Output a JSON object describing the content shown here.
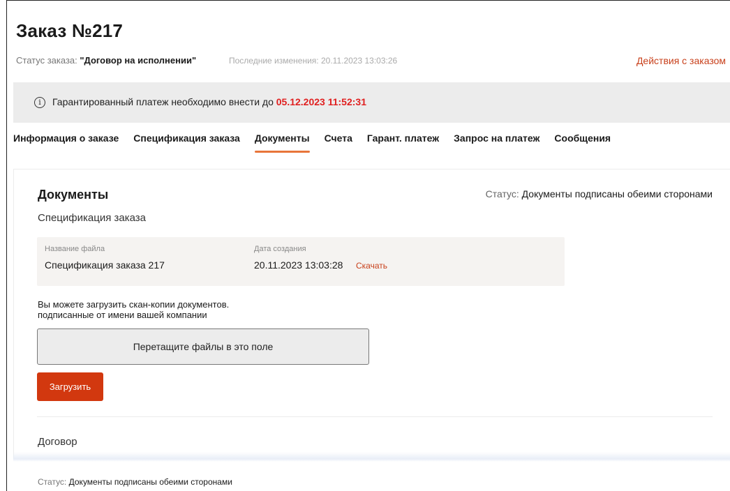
{
  "header": {
    "title": "Заказ №217",
    "status_label": "Статус заказа:",
    "status_value": "\"Договор на исполнении\"",
    "last_change": "Последние изменения: 20.11.2023 13:03:26",
    "actions_link": "Действия с заказом"
  },
  "notice": {
    "icon": "info-icon",
    "text": "Гарантированный платеж необходимо внести до",
    "deadline": "05.12.2023 11:52:31",
    "deadline_color": "#e02020"
  },
  "tabs": [
    {
      "label": "Информация о заказе",
      "active": false
    },
    {
      "label": "Спецификация заказа",
      "active": false
    },
    {
      "label": "Документы",
      "active": true
    },
    {
      "label": "Счета",
      "active": false
    },
    {
      "label": "Гарант. платеж",
      "active": false
    },
    {
      "label": "Запрос на платеж",
      "active": false
    },
    {
      "label": "Сообщения",
      "active": false
    }
  ],
  "documents": {
    "title": "Документы",
    "status_label": "Статус:",
    "status_value": "Документы подписаны обеими сторонами",
    "specification": {
      "section_title": "Спецификация заказа",
      "file_name_label": "Название файла",
      "file_name": "Спецификация заказа 217",
      "date_label": "Дата создания",
      "date": "20.11.2023 13:03:28",
      "download_label": "Скачать"
    },
    "upload": {
      "hint_line1": "Вы можете загрузить скан-копии документов.",
      "hint_line2": "подписанные от имени вашей компании",
      "dropzone_text": "Перетащите файлы в это поле",
      "button_label": "Загрузить"
    },
    "contract": {
      "section_title": "Договор",
      "status_label": "Статус:",
      "status_value": "Документы подписаны обеими сторонами"
    }
  },
  "colors": {
    "accent": "#d2380f",
    "link": "#c8401b",
    "tab_underline": "#e8753a"
  }
}
